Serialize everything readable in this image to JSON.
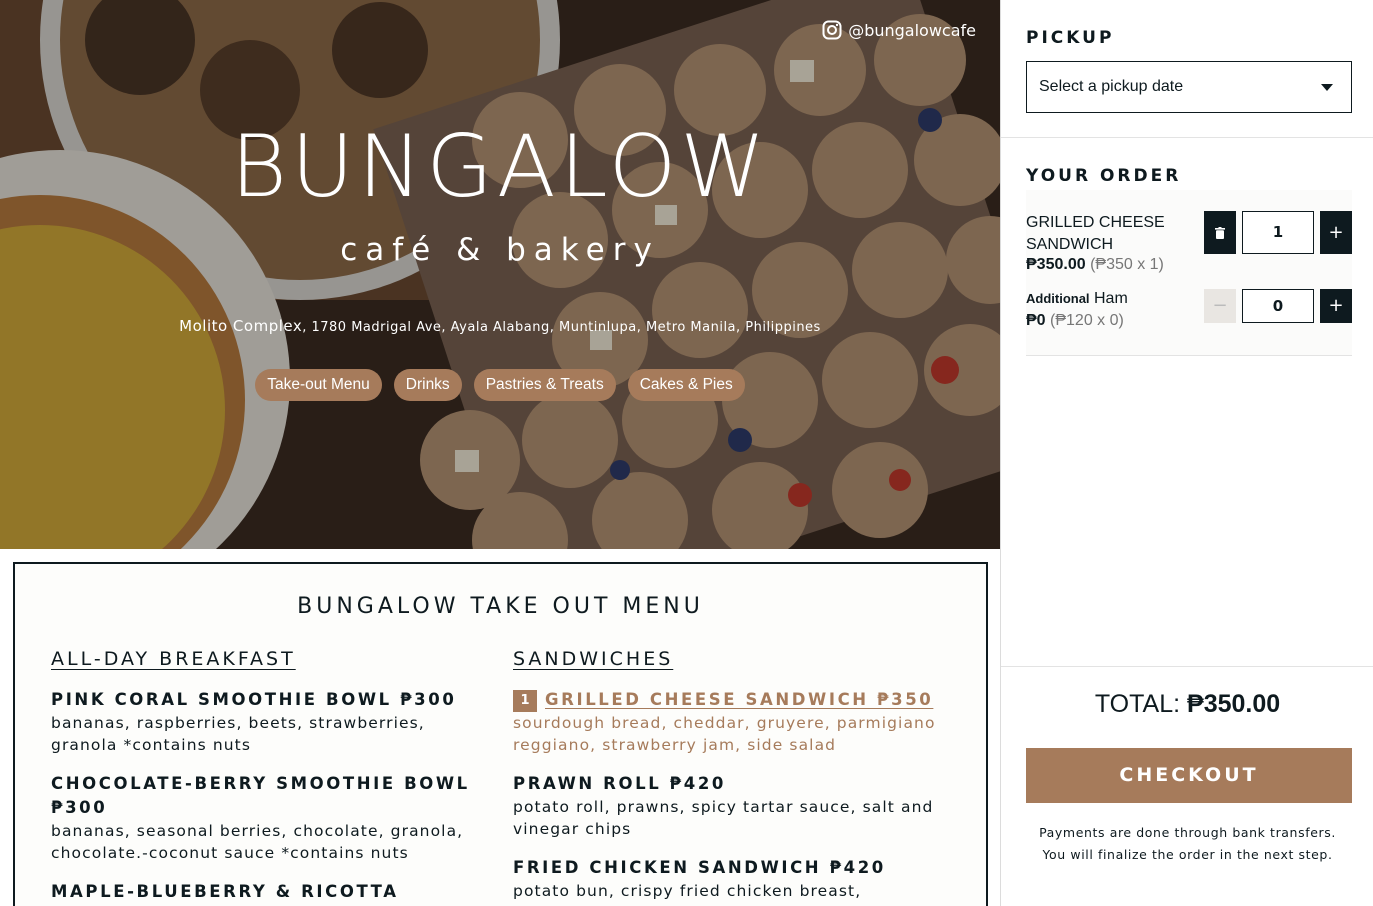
{
  "hero": {
    "instagram_handle": "@bungalowcafe",
    "logo_title": "BUNGALOW",
    "logo_subtitle": "café & bakery",
    "address_name": "Molito Complex",
    "address_rest": ", 1780 Madrigal Ave, Ayala Alabang, Muntinlupa, Metro Manila, Philippines",
    "categories": [
      "Take-out Menu",
      "Drinks",
      "Pastries & Treats",
      "Cakes & Pies"
    ]
  },
  "menu": {
    "title": "BUNGALOW TAKE OUT MENU",
    "sections": [
      {
        "title": "ALL-DAY BREAKFAST",
        "items": [
          {
            "name": "PINK CORAL SMOOTHIE BOWL ₱300",
            "desc": "bananas, raspberries, beets, strawberries, granola *contains nuts"
          },
          {
            "name": "CHOCOLATE-BERRY SMOOTHIE BOWL ₱300",
            "desc": "bananas, seasonal berries, chocolate, granola, chocolate.-coconut sauce *contains nuts"
          },
          {
            "name": "MAPLE-BLUEBERRY & RICOTTA",
            "desc": ""
          }
        ]
      },
      {
        "title": "SANDWICHES",
        "items": [
          {
            "name": "GRILLED CHEESE SANDWICH ₱350",
            "desc": "sourdough bread, cheddar, gruyere, parmigiano reggiano, strawberry jam, side salad",
            "qty_badge": "1"
          },
          {
            "name": "PRAWN ROLL ₱420",
            "desc": "potato roll, prawns, spicy tartar sauce, salt and vinegar chips"
          },
          {
            "name": "FRIED CHICKEN SANDWICH ₱420",
            "desc": "potato bun, crispy fried chicken breast,"
          }
        ]
      }
    ]
  },
  "sidebar": {
    "pickup_heading": "PICKUP",
    "pickup_placeholder": "Select a pickup date",
    "order_heading": "YOUR ORDER",
    "order_item": {
      "name": "GRILLED CHEESE SANDWICH",
      "line_total": "₱350.00",
      "unit_detail": "(₱350 x 1)",
      "quantity": "1"
    },
    "addon": {
      "prefix": "Additional",
      "name": "Ham",
      "line_total": "₱0",
      "unit_detail": "(₱120 x 0)",
      "quantity": "0"
    },
    "total_label": "TOTAL:",
    "total_amount": "₱350.00",
    "checkout_label": "CHECKOUT",
    "payment_note_1": "Payments are done through bank transfers.",
    "payment_note_2": "You will finalize the order in the next step."
  },
  "colors": {
    "accent": "#a67b5b",
    "dark": "#0e1a1f"
  },
  "icons": [
    "instagram-icon",
    "chevron-down-icon",
    "trash-icon",
    "plus-icon",
    "minus-icon"
  ]
}
